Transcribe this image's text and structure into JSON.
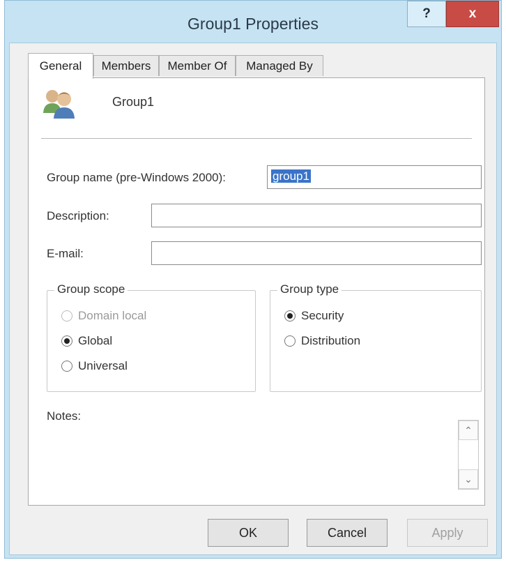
{
  "window": {
    "title": "Group1 Properties",
    "help_label": "?",
    "close_label": "x"
  },
  "tabs": [
    {
      "label": "General",
      "active": true
    },
    {
      "label": "Members",
      "active": false
    },
    {
      "label": "Member Of",
      "active": false
    },
    {
      "label": "Managed By",
      "active": false
    }
  ],
  "general": {
    "group_display_name": "Group1",
    "group_name_label": "Group name (pre-Windows 2000):",
    "group_name_value": "group1",
    "description_label": "Description:",
    "description_value": "",
    "email_label": "E-mail:",
    "email_value": "",
    "group_scope": {
      "legend": "Group scope",
      "options": [
        {
          "label": "Domain local",
          "selected": false,
          "enabled": false
        },
        {
          "label": "Global",
          "selected": true,
          "enabled": true
        },
        {
          "label": "Universal",
          "selected": false,
          "enabled": true
        }
      ]
    },
    "group_type": {
      "legend": "Group type",
      "options": [
        {
          "label": "Security",
          "selected": true,
          "enabled": true
        },
        {
          "label": "Distribution",
          "selected": false,
          "enabled": true
        }
      ]
    },
    "notes_label": "Notes:",
    "notes_value": ""
  },
  "buttons": {
    "ok": "OK",
    "cancel": "Cancel",
    "apply": "Apply"
  },
  "colors": {
    "titlebar": "#c6e3f4",
    "close_button": "#c94b45",
    "selection": "#3a73c8"
  }
}
